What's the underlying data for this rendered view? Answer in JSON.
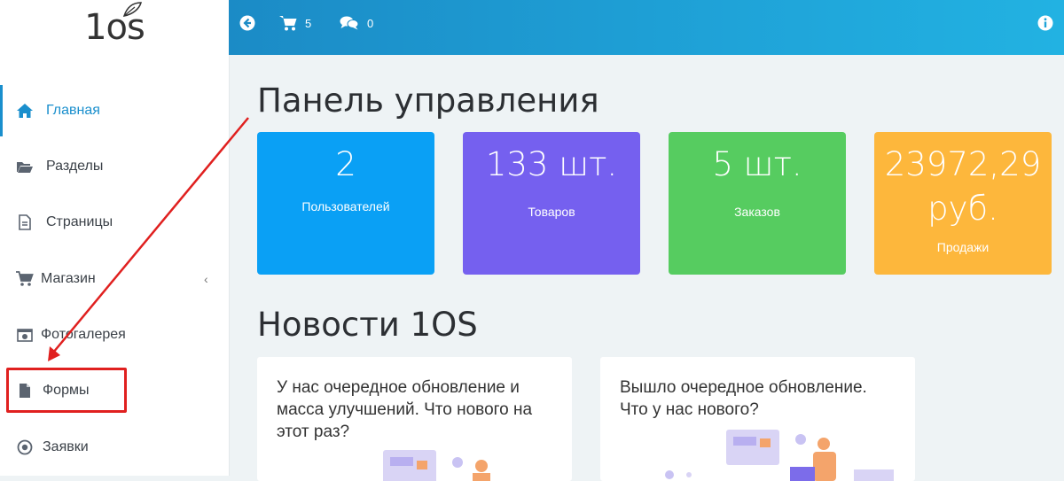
{
  "logo": {
    "text": "1os"
  },
  "sidebar": {
    "items": [
      {
        "label": "Главная",
        "icon": "home-icon",
        "active": true
      },
      {
        "label": "Разделы",
        "icon": "folder-open-icon"
      },
      {
        "label": "Страницы",
        "icon": "file-icon"
      },
      {
        "label": "Магазин",
        "icon": "cart-icon",
        "chevron": "‹"
      },
      {
        "label": "Фотогалерея",
        "icon": "camera-icon"
      },
      {
        "label": "Формы",
        "icon": "document-icon"
      },
      {
        "label": "Заявки",
        "icon": "target-icon"
      }
    ]
  },
  "topbar": {
    "cart_count": "5",
    "comments_count": "0"
  },
  "main": {
    "title": "Панель управления",
    "stats": [
      {
        "value": "2",
        "label": "Пользователей",
        "color": "#0aa0f5"
      },
      {
        "value": "133 шт.",
        "label": "Товаров",
        "color": "#7560ef"
      },
      {
        "value": "5 шт.",
        "label": "Заказов",
        "color": "#56cc60"
      },
      {
        "value": "23972,29",
        "value2": "руб.",
        "label": "Продажи",
        "color": "#fdb73c"
      }
    ],
    "news_title": "Новости 1OS",
    "news": [
      {
        "text": "У нас очередное обновление и масса улучшений. Что нового на этот раз?"
      },
      {
        "text": "Вышло очередное обновление. Что у нас нового?"
      }
    ]
  },
  "colors": {
    "accent": "#1a8fcd",
    "highlight": "#e0201f"
  }
}
